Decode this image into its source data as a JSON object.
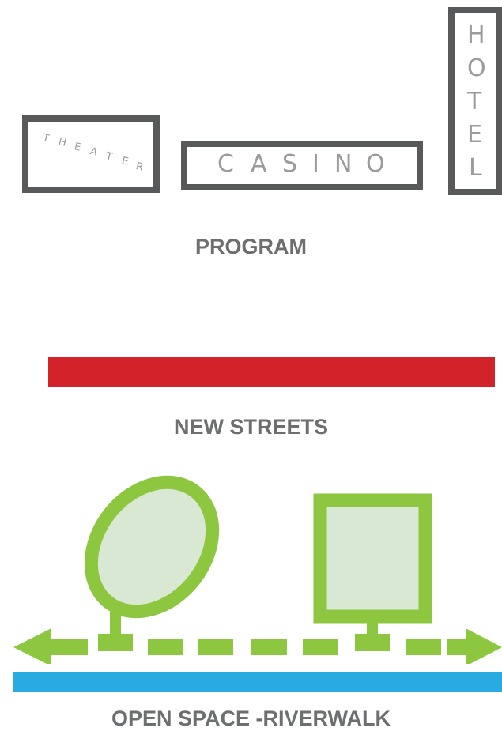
{
  "program": {
    "theater_label": "THEATER",
    "casino_label": "CASINO",
    "hotel_label": "HOTEL",
    "caption": "PROGRAM"
  },
  "streets": {
    "caption": "NEW STREETS",
    "color": "#d2232a"
  },
  "open_space": {
    "caption": "OPEN SPACE -RIVERWALK",
    "green_color": "#8dc63f",
    "green_fill": "#d8e8d2",
    "river_color": "#29abe2"
  },
  "colors": {
    "box_border": "#58595b",
    "box_text": "#9a9b9d",
    "caption_text": "#6d6e70"
  }
}
